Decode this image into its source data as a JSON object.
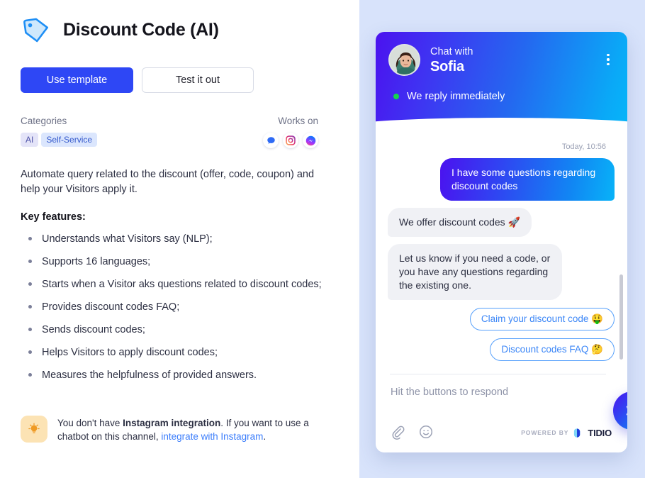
{
  "header": {
    "title": "Discount Code (AI)",
    "icon": "tag-icon"
  },
  "actions": {
    "use_template_label": "Use template",
    "test_it_out_label": "Test it out"
  },
  "meta": {
    "categories_label": "Categories",
    "categories": [
      "AI",
      "Self-Service"
    ],
    "works_on_label": "Works on",
    "channels": [
      "live-chat-icon",
      "instagram-icon",
      "messenger-icon"
    ]
  },
  "content": {
    "description": "Automate query related to the discount (offer, code, coupon) and help your Visitors apply it.",
    "key_features_label": "Key features:",
    "features": [
      "Understands what Visitors say (NLP);",
      "Supports 16 languages;",
      "Starts when a Visitor aks questions related to discount codes;",
      "Provides discount codes FAQ;",
      "Sends discount codes;",
      "Helps Visitors to apply discount codes;",
      "Measures the helpfulness of provided answers."
    ]
  },
  "hint": {
    "icon": "lightbulb-icon",
    "text_before": "You don't have ",
    "text_bold": "Instagram integration",
    "text_middle": ". If you want to use a chatbot on this channel, ",
    "link_text": "integrate with Instagram",
    "text_after": "."
  },
  "widget": {
    "chat_with_label": "Chat with",
    "agent_name": "Sofia",
    "status_text": "We reply immediately",
    "timestamp": "Today, 10:56",
    "messages": [
      {
        "from": "visitor",
        "text": "I have some questions regarding discount codes"
      },
      {
        "from": "bot",
        "text": "We offer discount codes 🚀"
      },
      {
        "from": "bot",
        "text": "Let us know if you need a code, or you have any questions regarding the existing one."
      }
    ],
    "quick_replies": [
      "Claim your discount code 🤑",
      "Discount codes FAQ 🤔"
    ],
    "input_placeholder": "Hit the buttons to respond",
    "footer_icons": [
      "attachment-icon",
      "emoji-icon"
    ],
    "powered_by_label": "POWERED BY",
    "brand_name": "TIDIO",
    "send_icon": "send-icon"
  },
  "colors": {
    "primary": "#2e47f5",
    "link": "#3b7dfb",
    "panel_bg": "#d8e3fb",
    "status_dot": "#15d44e",
    "quick_reply_border": "#56a0fb"
  }
}
